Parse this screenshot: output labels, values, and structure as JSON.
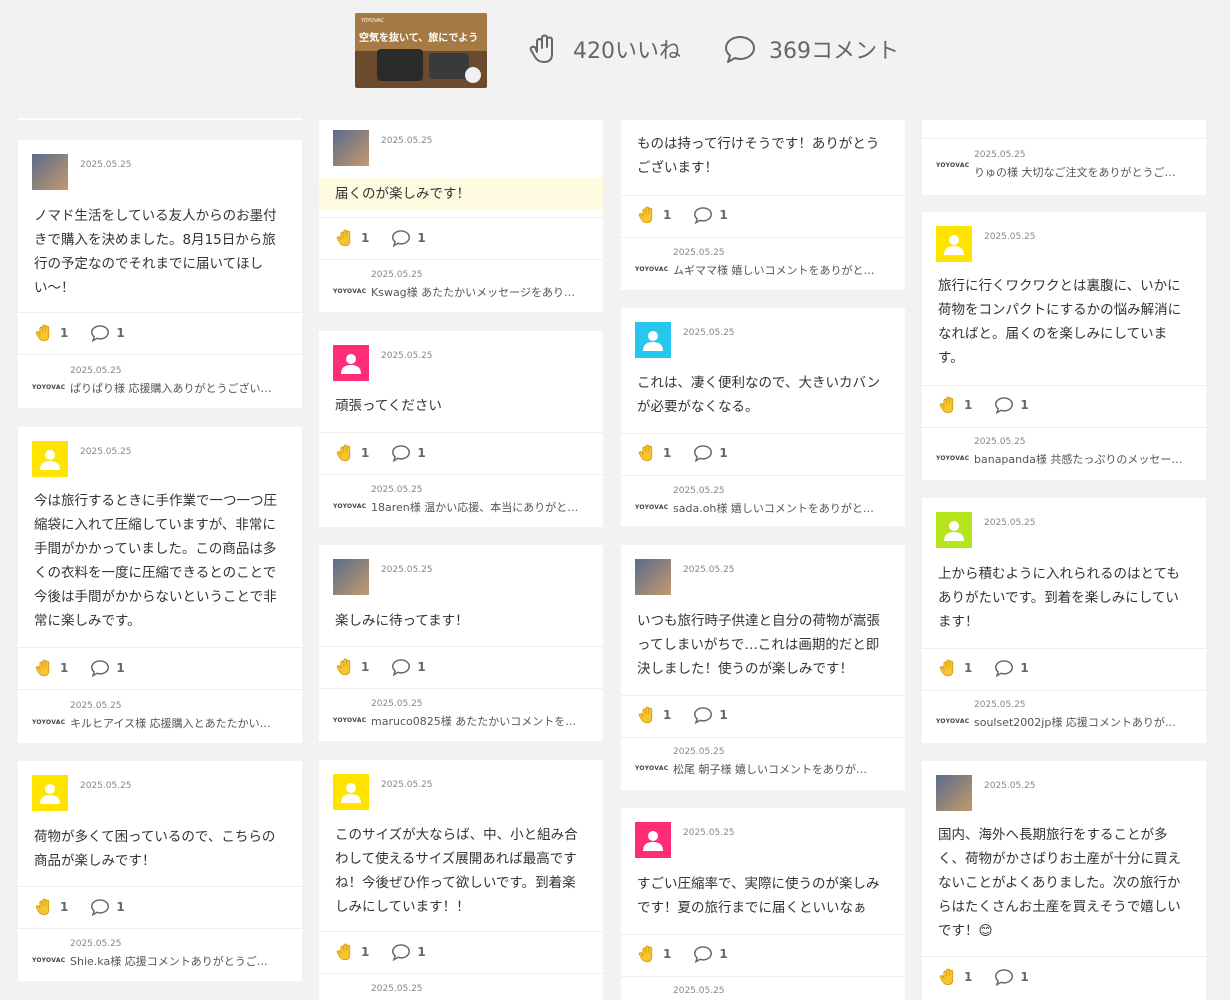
{
  "header": {
    "likes": "420いいね",
    "comments": "369コメント",
    "thumb_brand": "YOYOVAC",
    "thumb_text": "空気を抜いて、旅にでよう"
  },
  "reply_brand": "YOYOVAC",
  "date": "2025.05.25",
  "count_like": "1",
  "count_comment": "1",
  "columns": [
    [
      {
        "text": "ノマド生活をしている友人からのお墨付きで購入を決めました。8月15日から旅行の予定なのでそれまでに届いてほしい〜！",
        "reply": "ぱりぱり様 応援購入ありがとうござい…"
      },
      {
        "text": "今は旅行するときに手作業で一つ一つ圧縮袋に入れて圧縮していますが、非常に手間がかかっていました。この商品は多くの衣料を一度に圧縮できるとのことで今後は手間がかからないということで非常に楽しみです。",
        "reply": "キルヒアイス様 応援購入とあたたかい…"
      },
      {
        "text": "荷物が多くて困っているので、こちらの商品が楽しみです！",
        "reply": "Shie.ka様 応援コメントありがとうご…"
      }
    ],
    [
      {
        "text": "届くのが楽しみです！",
        "reply": "Kswag様 あたたかいメッセージをあり…"
      },
      {
        "text": "頑張ってください",
        "reply": "18aren様 温かい応援、本当にありがと…"
      },
      {
        "text": "楽しみに待ってます！",
        "reply": "maruco0825様 あたたかいコメントを…"
      },
      {
        "text": "このサイズが大ならば、中、小と組み合わして使えるサイズ展開あれば最高ですね！今後ぜひ作って欲しいです。到着楽しみにしています！！",
        "reply": ""
      }
    ],
    [
      {
        "text": "ものは持って行けそうです！ありがとうございます！",
        "reply": "ムギママ様 嬉しいコメントをありがと…"
      },
      {
        "text": "これは、凄く便利なので、大きいカバンが必要がなくなる。",
        "reply": "sada.oh様 嬉しいコメントをありがと…"
      },
      {
        "text": "いつも旅行時子供達と自分の荷物が嵩張ってしまいがちで…これは画期的だと即決しました！使うのが楽しみです！",
        "reply": "松尾 朝子様 嬉しいコメントをありが…"
      },
      {
        "text": "すごい圧縮率で、実際に使うのが楽しみです！夏の旅行までに届くといいなぁ",
        "reply": ""
      }
    ],
    [
      {
        "text": "",
        "reply": "りゅの様 大切なご注文をありがとうご…"
      },
      {
        "text": "旅行に行くワクワクとは裏腹に、いかに荷物をコンパクトにするかの悩み解消になればと。届くのを楽しみにしています。",
        "reply": "banapanda様 共感たっぷりのメッセー…"
      },
      {
        "text": "上から積むように入れられるのはとてもありがたいです。到着を楽しみにしています！",
        "reply": "soulset2002jp様 応援コメントありがと…"
      },
      {
        "text": "国内、海外へ長期旅行をすることが多く、荷物がかさばりお土産が十分に買えないことがよくありました。次の旅行からはたくさんお土産を買えそうで嬉しいです！😊",
        "reply": ""
      }
    ]
  ]
}
